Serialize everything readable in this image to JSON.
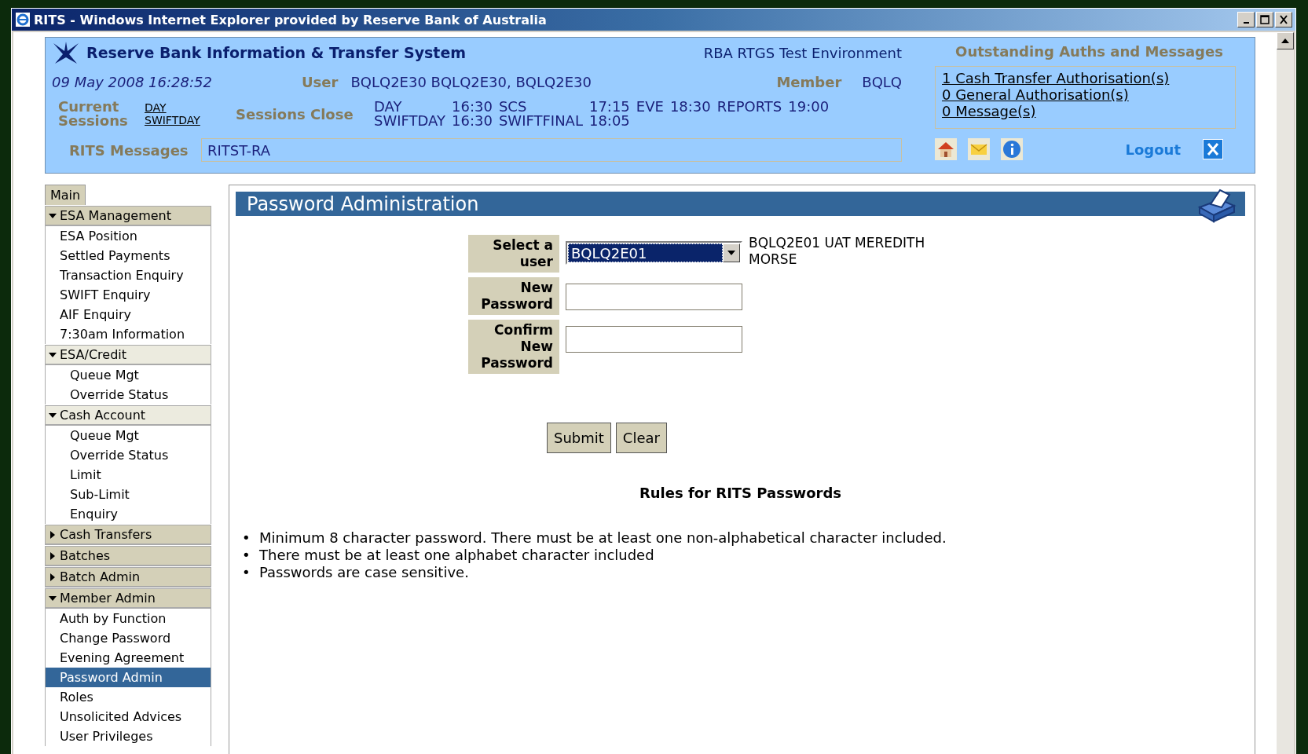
{
  "window": {
    "title": "RITS - Windows Internet Explorer provided by Reserve Bank of Australia"
  },
  "header": {
    "system_name": "Reserve Bank Information & Transfer System",
    "environment": "RBA RTGS Test Environment",
    "date_time": "09 May 2008 16:28:52",
    "user_label": "User",
    "user": "BQLQ2E30 BQLQ2E30, BQLQ2E30",
    "member_label": "Member",
    "member": "BQLQ",
    "current_sessions_label": "Current Sessions",
    "current_sessions": [
      "DAY",
      "SWIFTDAY"
    ],
    "sessions_close_label": "Sessions Close",
    "sessions_close": [
      [
        {
          "name": "DAY",
          "time": "16:30"
        },
        {
          "name": "SCS",
          "time": "17:15"
        },
        {
          "name": "EVE",
          "time": "18:30"
        },
        {
          "name": "REPORTS",
          "time": "19:00"
        }
      ],
      [
        {
          "name": "SWIFTDAY",
          "time": "16:30"
        },
        {
          "name": "SWIFTFINAL",
          "time": "18:05"
        }
      ]
    ],
    "messages_label": "RITS Messages",
    "messages_value": "RITST-RA",
    "outstanding_title": "Outstanding Auths and Messages",
    "outstanding_links": [
      "1 Cash Transfer Authorisation(s)",
      "0 General Authorisation(s)",
      "0 Message(s)"
    ],
    "logout": "Logout"
  },
  "sidebar": {
    "tab": "Main",
    "groups": [
      {
        "label": "ESA Management",
        "kind": "section",
        "expanded": true,
        "items": [
          {
            "label": "ESA Position",
            "selected": false
          },
          {
            "label": "Settled Payments",
            "selected": false
          },
          {
            "label": "Transaction Enquiry",
            "selected": false
          },
          {
            "label": "SWIFT Enquiry",
            "selected": false
          },
          {
            "label": "AIF Enquiry",
            "selected": false
          },
          {
            "label": "7:30am Information",
            "selected": false
          }
        ]
      },
      {
        "label": "ESA/Credit",
        "kind": "subsection",
        "expanded": true,
        "items": [
          {
            "label": "Queue Mgt",
            "selected": false
          },
          {
            "label": "Override Status",
            "selected": false
          }
        ]
      },
      {
        "label": "Cash Account",
        "kind": "subsection",
        "expanded": true,
        "items": [
          {
            "label": "Queue Mgt",
            "selected": false
          },
          {
            "label": "Override Status",
            "selected": false
          },
          {
            "label": "Limit",
            "selected": false
          },
          {
            "label": "Sub-Limit",
            "selected": false
          },
          {
            "label": "Enquiry",
            "selected": false
          }
        ]
      },
      {
        "label": "Cash Transfers",
        "kind": "section",
        "expanded": false
      },
      {
        "label": "Batches",
        "kind": "section",
        "expanded": false
      },
      {
        "label": "Batch Admin",
        "kind": "section",
        "expanded": false
      },
      {
        "label": "Member Admin",
        "kind": "section",
        "expanded": true,
        "items": [
          {
            "label": "Auth by Function",
            "selected": false
          },
          {
            "label": "Change Password",
            "selected": false
          },
          {
            "label": "Evening Agreement",
            "selected": false
          },
          {
            "label": "Password Admin",
            "selected": true
          },
          {
            "label": "Roles",
            "selected": false
          },
          {
            "label": "Unsolicited Advices",
            "selected": false
          },
          {
            "label": "User Privileges",
            "selected": false
          }
        ]
      }
    ]
  },
  "panel": {
    "title": "Password Administration",
    "fields": [
      {
        "label": "Select a user",
        "kind": "select",
        "value": "BQLQ2E01",
        "note": "BQLQ2E01 UAT MEREDITH MORSE"
      },
      {
        "label": "New Password",
        "kind": "password"
      },
      {
        "label": "Confirm New Password",
        "kind": "password"
      }
    ],
    "buttons": [
      "Submit",
      "Clear"
    ],
    "rules_title": "Rules for RITS Passwords",
    "rules": [
      {
        "marker": "•",
        "text": "Minimum 8 character password. There must be at least one non-alphabetical character included."
      },
      {
        "marker": "•",
        "text": "There must be at least one alphabet character included"
      },
      {
        "marker": "•",
        "text": "Passwords are case sensitive."
      }
    ]
  }
}
